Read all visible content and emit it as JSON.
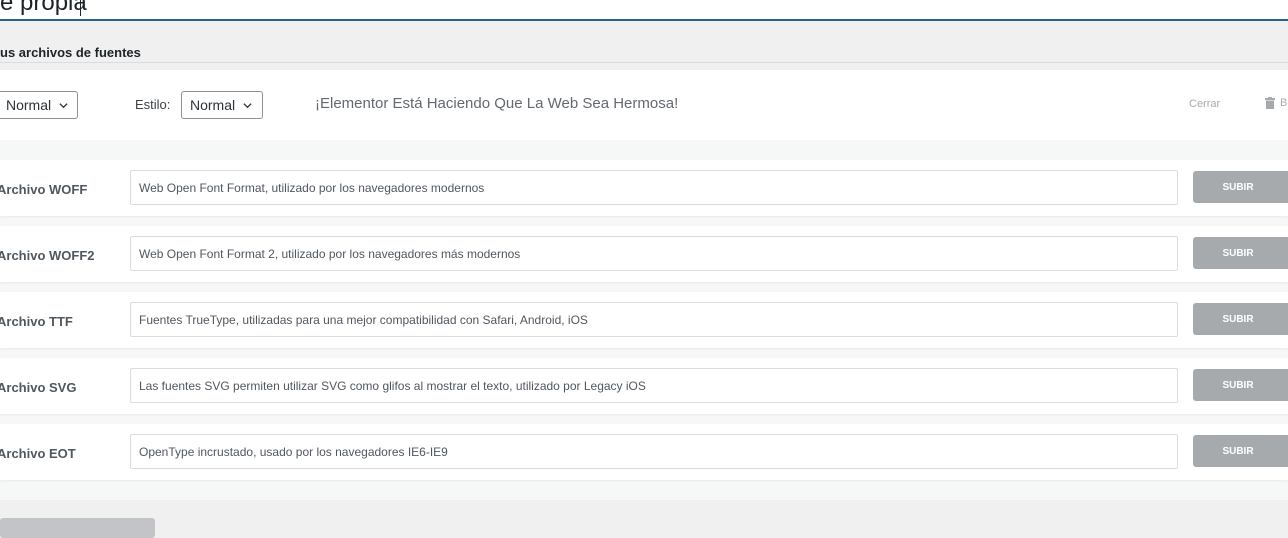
{
  "title": {
    "value": "e propia"
  },
  "section_heading": "us archivos de fuentes",
  "variation": {
    "weight_value": "Normal",
    "style_label": "Estilo:",
    "style_value": "Normal",
    "preview_text": "¡Elementor Está Haciendo Que La Web Sea Hermosa!",
    "close_label": "Cerrar",
    "delete_label": "B"
  },
  "file_rows": [
    {
      "label": "Archivo WOFF",
      "placeholder": "Web Open Font Format, utilizado por los navegadores modernos",
      "button": "SUBIR"
    },
    {
      "label": "Archivo WOFF2",
      "placeholder": "Web Open Font Format 2, utilizado por los navegadores más modernos",
      "button": "SUBIR"
    },
    {
      "label": "Archivo TTF",
      "placeholder": "Fuentes TrueType, utilizadas para una mejor compatibilidad con Safari, Android, iOS",
      "button": "SUBIR"
    },
    {
      "label": "Archivo SVG",
      "placeholder": "Las fuentes SVG permiten utilizar SVG como glifos al mostrar el texto, utilizado por Legacy iOS",
      "button": "SUBIR"
    },
    {
      "label": "Archivo EOT",
      "placeholder": "OpenType incrustado, usado por los navegadores IE6-IE9",
      "button": "SUBIR"
    }
  ],
  "colors": {
    "accent_underline": "#2c5f89",
    "upload_button": "#a7aaad",
    "page_background": "#f0f0f1"
  },
  "icons": {
    "select_arrow": "chevron-down-icon",
    "delete": "trash-icon"
  }
}
